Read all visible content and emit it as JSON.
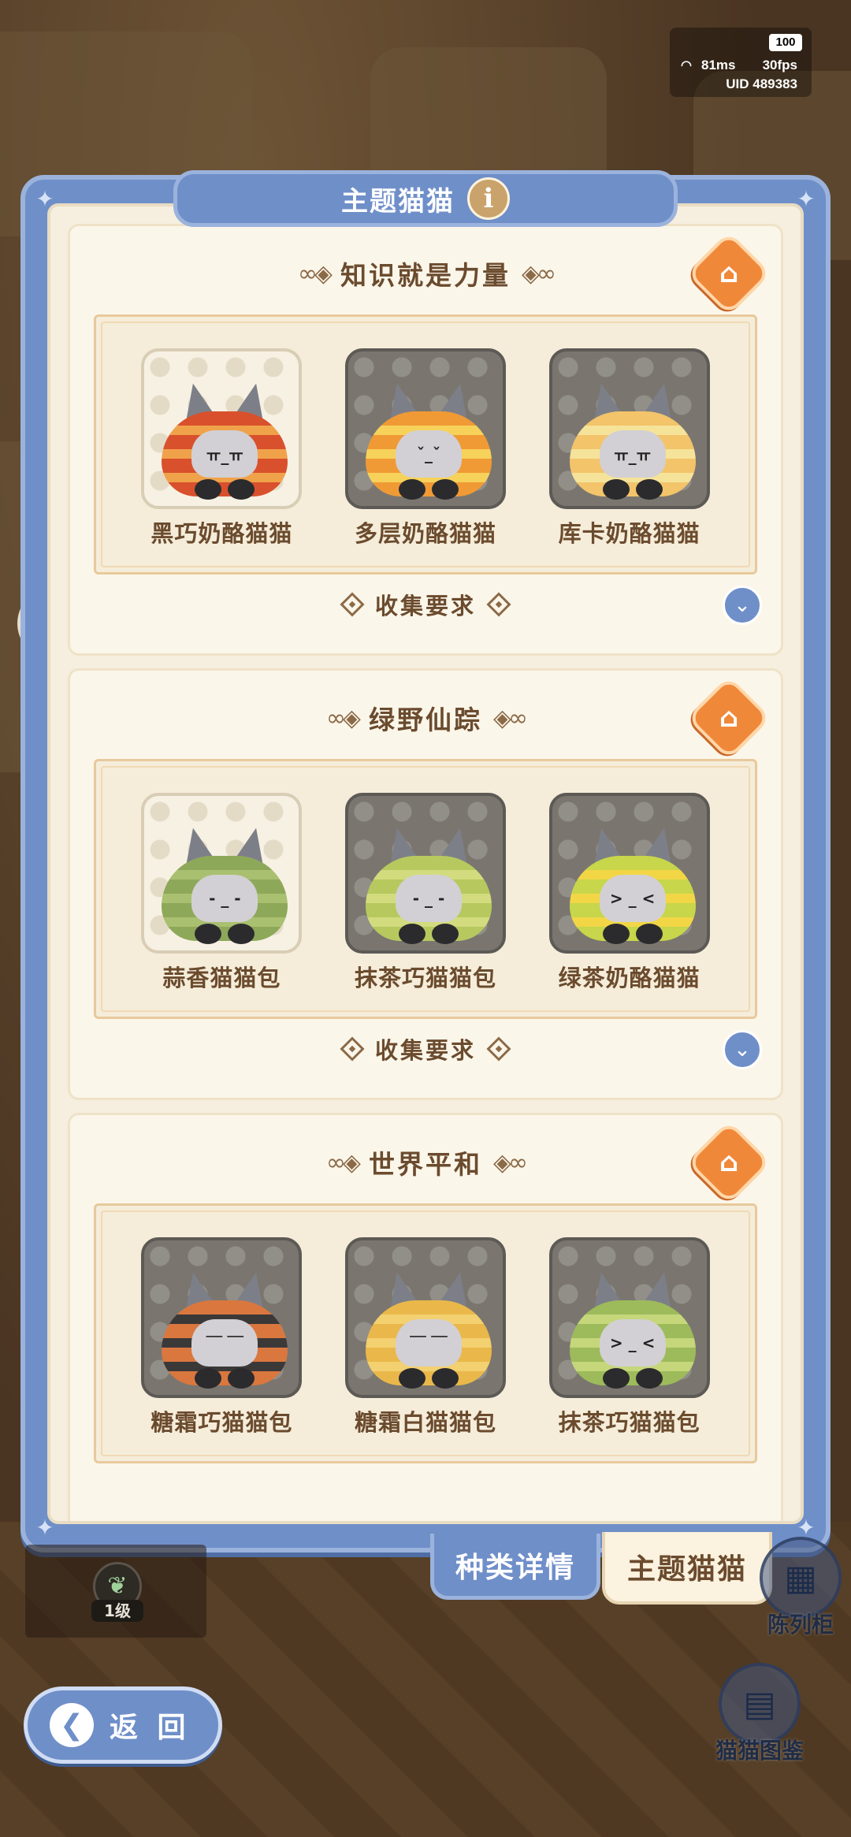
{
  "status": {
    "battery": "100",
    "ping": "81ms",
    "fps": "30fps",
    "uid": "UID  489383"
  },
  "panel": {
    "title": "主题猫猫",
    "info_glyph": "i",
    "sections": [
      {
        "title": "知识就是力量",
        "cards": [
          {
            "label": "黑巧奶酪猫猫",
            "owned": true,
            "color": "#d9502c",
            "stripe": "#f0a24a",
            "face": "ㅠ_ㅠ"
          },
          {
            "label": "多层奶酪猫猫",
            "owned": false,
            "color": "#f09a35",
            "stripe": "#f7d25a",
            "face": "ˇ_ˇ"
          },
          {
            "label": "库卡奶酪猫猫",
            "owned": false,
            "color": "#f3c46a",
            "stripe": "#f6e39a",
            "face": "ㅠ_ㅠ"
          }
        ],
        "collect_label": "收集要求"
      },
      {
        "title": "绿野仙踪",
        "cards": [
          {
            "label": "蒜香猫猫包",
            "owned": true,
            "color": "#8ea85a",
            "stripe": "#a9c070",
            "face": "- _ -"
          },
          {
            "label": "抹茶巧猫猫包",
            "owned": false,
            "color": "#b7c95e",
            "stripe": "#d2dc7e",
            "face": "- _ -"
          },
          {
            "label": "绿茶奶酪猫猫",
            "owned": false,
            "color": "#c7d64a",
            "stripe": "#f2d646",
            "face": "> _ <"
          }
        ],
        "collect_label": "收集要求"
      },
      {
        "title": "世界平和",
        "cards": [
          {
            "label": "糖霜巧猫猫包",
            "owned": false,
            "color": "#d9773f",
            "stripe": "#3b3838",
            "face": "￣ ￣"
          },
          {
            "label": "糖霜白猫猫包",
            "owned": false,
            "color": "#eab84a",
            "stripe": "#f3d070",
            "face": "￣ ￣"
          },
          {
            "label": "抹茶巧猫猫包",
            "owned": false,
            "color": "#9dbb5a",
            "stripe": "#c5d77a",
            "face": "> _ <"
          }
        ],
        "collect_label": ""
      }
    ]
  },
  "tabs": {
    "kind_details": "种类详情",
    "theme_cats": "主题猫猫"
  },
  "level": {
    "text": "1级"
  },
  "side": {
    "display_cabinet": "陈列柜",
    "cat_catalog": "猫猫图鉴"
  },
  "back": {
    "label": "返 回"
  },
  "colors": {
    "panel_blue": "#6f8fc9",
    "panel_cream": "#f6efdf",
    "text_brown": "#6b4b2e",
    "gift_orange": "#f0883a"
  }
}
